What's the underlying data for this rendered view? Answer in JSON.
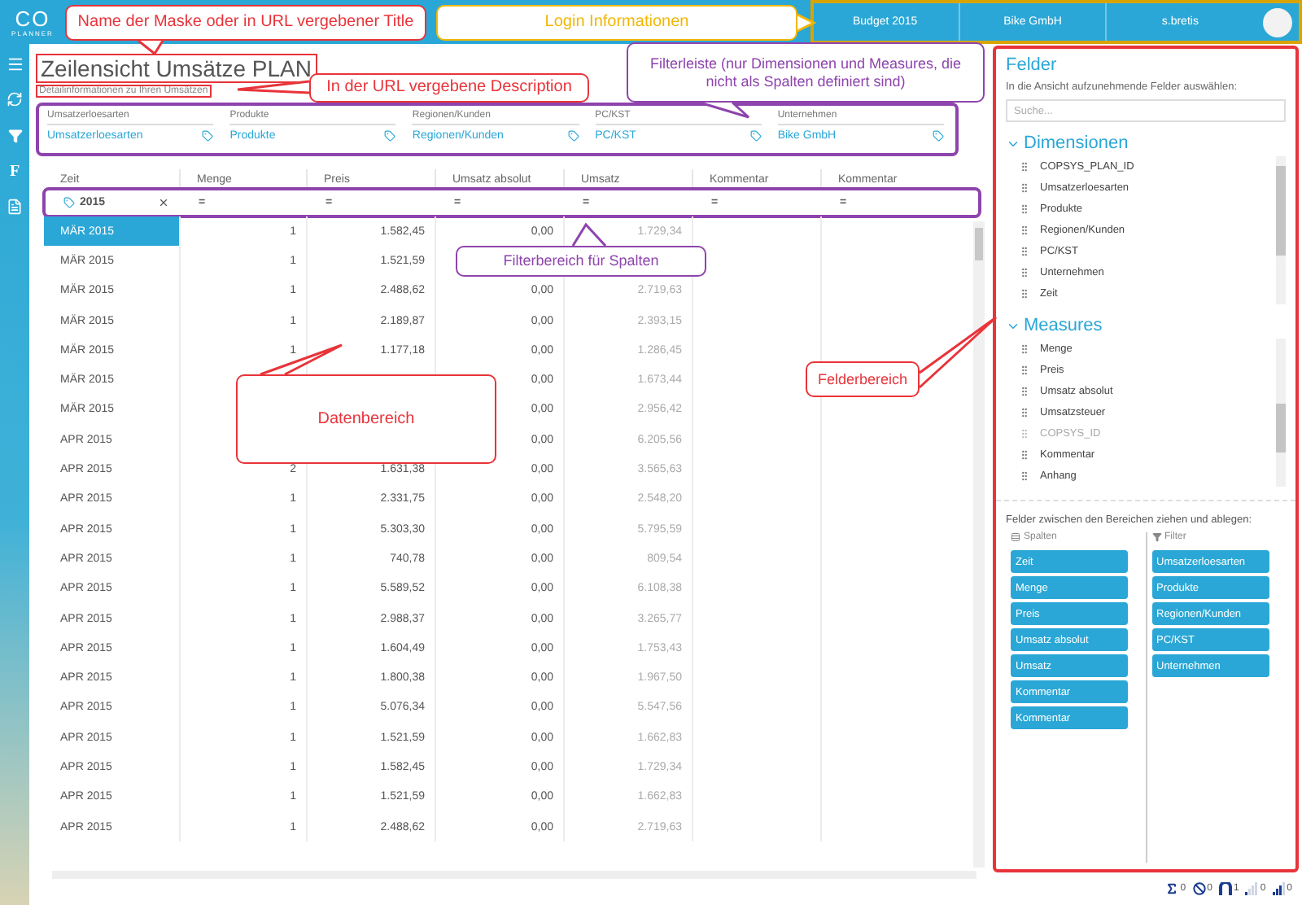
{
  "logo": {
    "top": "CO",
    "bottom": "PLANNER"
  },
  "header": {
    "segments": [
      "Budget 2015",
      "Bike GmbH",
      "s.bretis"
    ]
  },
  "sidebar": {
    "items": [
      {
        "kind": "menu"
      },
      {
        "kind": "refresh"
      },
      {
        "kind": "filter"
      },
      {
        "kind": "letter",
        "text": "F"
      },
      {
        "kind": "document"
      }
    ]
  },
  "page": {
    "title": "Zeilensicht Umsätze PLAN",
    "description": "Detailinformationen zu Ihren Umsätzen"
  },
  "filter_bar": [
    {
      "label": "Umsatzerloesarten",
      "value": "Umsatzerloesarten"
    },
    {
      "label": "Produkte",
      "value": "Produkte"
    },
    {
      "label": "Regionen/Kunden",
      "value": "Regionen/Kunden"
    },
    {
      "label": "PC/KST",
      "value": "PC/KST"
    },
    {
      "label": "Unternehmen",
      "value": "Bike GmbH"
    }
  ],
  "table": {
    "columns": [
      {
        "label": "Zeit",
        "kind": "dimension",
        "filter": "2015"
      },
      {
        "label": "Menge",
        "kind": "measure",
        "filter": "="
      },
      {
        "label": "Preis",
        "kind": "measure",
        "filter": "="
      },
      {
        "label": "Umsatz absolut",
        "kind": "measure",
        "filter": "="
      },
      {
        "label": "Umsatz",
        "kind": "calculated",
        "filter": "="
      },
      {
        "label": "Kommentar",
        "kind": "measure",
        "filter": "="
      },
      {
        "label": "Kommentar",
        "kind": "measure",
        "filter": "="
      }
    ],
    "rows": [
      {
        "selected": true,
        "cells": [
          "MÄR 2015",
          "1",
          "1.582,45",
          "0,00",
          "1.729,34",
          null,
          null
        ]
      },
      {
        "selected": false,
        "cells": [
          "MÄR 2015",
          "1",
          "1.521,59",
          null,
          null,
          null,
          null
        ]
      },
      {
        "selected": false,
        "cells": [
          "MÄR 2015",
          "1",
          "2.488,62",
          "0,00",
          "2.719,63",
          null,
          null
        ]
      },
      {
        "selected": false,
        "cells": [
          "MÄR 2015",
          "1",
          "2.189,87",
          "0,00",
          "2.393,15",
          null,
          null
        ]
      },
      {
        "selected": false,
        "cells": [
          "MÄR 2015",
          "1",
          "1.177,18",
          "0,00",
          "1.286,45",
          null,
          null
        ]
      },
      {
        "selected": false,
        "cells": [
          "MÄR 2015",
          null,
          null,
          "0,00",
          "1.673,44",
          null,
          null
        ]
      },
      {
        "selected": false,
        "cells": [
          "MÄR 2015",
          null,
          null,
          "0,00",
          "2.956,42",
          null,
          null
        ]
      },
      {
        "selected": false,
        "cells": [
          "APR 2015",
          null,
          null,
          "0,00",
          "6.205,56",
          null,
          null
        ]
      },
      {
        "selected": false,
        "cells": [
          "APR 2015",
          "2",
          "1.631,38",
          "0,00",
          "3.565,63",
          null,
          null
        ]
      },
      {
        "selected": false,
        "cells": [
          "APR 2015",
          "1",
          "2.331,75",
          "0,00",
          "2.548,20",
          null,
          null
        ]
      },
      {
        "selected": false,
        "cells": [
          "APR 2015",
          "1",
          "5.303,30",
          "0,00",
          "5.795,59",
          null,
          null
        ]
      },
      {
        "selected": false,
        "cells": [
          "APR 2015",
          "1",
          "740,78",
          "0,00",
          "809,54",
          null,
          null
        ]
      },
      {
        "selected": false,
        "cells": [
          "APR 2015",
          "1",
          "5.589,52",
          "0,00",
          "6.108,38",
          null,
          null
        ]
      },
      {
        "selected": false,
        "cells": [
          "APR 2015",
          "1",
          "2.988,37",
          "0,00",
          "3.265,77",
          null,
          null
        ]
      },
      {
        "selected": false,
        "cells": [
          "APR 2015",
          "1",
          "1.604,49",
          "0,00",
          "1.753,43",
          null,
          null
        ]
      },
      {
        "selected": false,
        "cells": [
          "APR 2015",
          "1",
          "1.800,38",
          "0,00",
          "1.967,50",
          null,
          null
        ]
      },
      {
        "selected": false,
        "cells": [
          "APR 2015",
          "1",
          "5.076,34",
          "0,00",
          "5.547,56",
          null,
          null
        ]
      },
      {
        "selected": false,
        "cells": [
          "APR 2015",
          "1",
          "1.521,59",
          "0,00",
          "1.662,83",
          null,
          null
        ]
      },
      {
        "selected": false,
        "cells": [
          "APR 2015",
          "1",
          "1.582,45",
          "0,00",
          "1.729,34",
          null,
          null
        ]
      },
      {
        "selected": false,
        "cells": [
          "APR 2015",
          "1",
          "1.521,59",
          "0,00",
          "1.662,83",
          null,
          null
        ]
      },
      {
        "selected": false,
        "cells": [
          "APR 2015",
          "1",
          "2.488,62",
          "0,00",
          "2.719,63",
          null,
          null
        ]
      }
    ]
  },
  "fields_panel": {
    "title": "Felder",
    "hint": "In die Ansicht aufzunehmende Felder auswählen:",
    "search": {
      "placeholder": "Suche..."
    },
    "groups": [
      {
        "title": "Dimensionen",
        "expanded": true,
        "items": [
          {
            "label": "COPSYS_PLAN_ID",
            "disabled": false
          },
          {
            "label": "Umsatzerloesarten",
            "disabled": false
          },
          {
            "label": "Produkte",
            "disabled": false
          },
          {
            "label": "Regionen/Kunden",
            "disabled": false
          },
          {
            "label": "PC/KST",
            "disabled": false
          },
          {
            "label": "Unternehmen",
            "disabled": false
          },
          {
            "label": "Zeit",
            "disabled": false
          }
        ]
      },
      {
        "title": "Measures",
        "expanded": true,
        "items": [
          {
            "label": "Menge",
            "disabled": false
          },
          {
            "label": "Preis",
            "disabled": false
          },
          {
            "label": "Umsatz absolut",
            "disabled": false
          },
          {
            "label": "Umsatzsteuer",
            "disabled": false
          },
          {
            "label": "COPSYS_ID",
            "disabled": true
          },
          {
            "label": "Kommentar",
            "disabled": false
          },
          {
            "label": "Anhang",
            "disabled": false
          }
        ]
      }
    ],
    "drop_hint": "Felder zwischen den Bereichen ziehen und ablegen:",
    "zones": [
      {
        "kind": "columns",
        "title": "Spalten",
        "items": [
          "Zeit",
          "Menge",
          "Preis",
          "Umsatz absolut",
          "Umsatz",
          "Kommentar",
          "Kommentar"
        ]
      },
      {
        "kind": "filter",
        "title": "Filter",
        "items": [
          "Umsatzerloesarten",
          "Produkte",
          "Regionen/Kunden",
          "PC/KST",
          "Unternehmen"
        ]
      }
    ]
  },
  "status_bar": [
    {
      "kind": "sum",
      "count": "0"
    },
    {
      "kind": "empty",
      "count": "0"
    },
    {
      "kind": "intersect",
      "count": "1"
    },
    {
      "kind": "signal-low",
      "count": "0"
    },
    {
      "kind": "signal-high",
      "count": "0"
    }
  ],
  "callouts": [
    {
      "text": "Name der Maske oder in URL vergebener Title",
      "color": "#e8343a"
    },
    {
      "text": "Login Informationen",
      "color": "#f2b705"
    },
    {
      "text": "In der URL vergebene Description",
      "color": "#e8343a"
    },
    {
      "text": "Filterleiste (nur Dimensionen und Measures, die nicht als Spalten definiert sind)",
      "color": "#8e44ad"
    },
    {
      "text": "Filterbereich für Spalten",
      "color": "#8e44ad"
    },
    {
      "text": "Datenbereich",
      "color": "#e8343a"
    },
    {
      "text": "Felderbereich",
      "color": "#e8343a"
    }
  ]
}
